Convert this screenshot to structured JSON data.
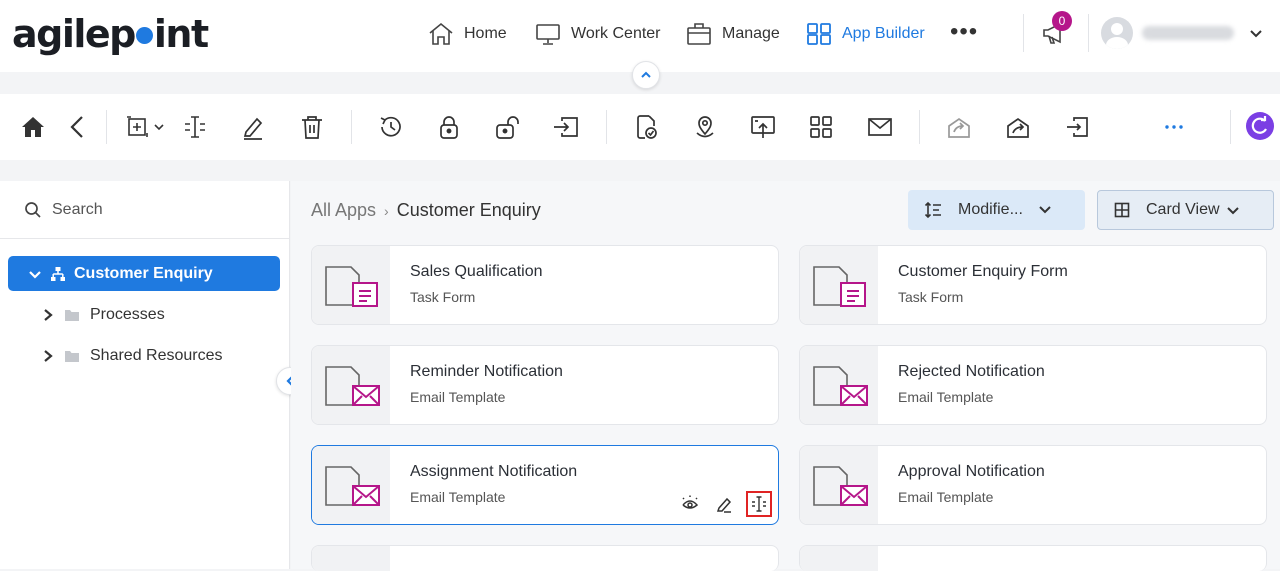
{
  "logo": {
    "text_before": "agilep",
    "text_after": "int"
  },
  "nav": {
    "home": "Home",
    "work_center": "Work Center",
    "manage": "Manage",
    "app_builder": "App Builder",
    "more": "•••",
    "notification_count": "0"
  },
  "sidebar": {
    "search_label": "Search",
    "tree": {
      "root": "Customer Enquiry",
      "children": [
        "Processes",
        "Shared Resources"
      ]
    }
  },
  "breadcrumb": {
    "root": "All Apps",
    "separator": "›",
    "current": "Customer Enquiry"
  },
  "controls": {
    "sort_label": "Modifie...",
    "view_label": "Card View"
  },
  "cards": [
    {
      "title": "Sales Qualification",
      "type": "Task Form"
    },
    {
      "title": "Customer Enquiry Form",
      "type": "Task Form"
    },
    {
      "title": "Reminder Notification",
      "type": "Email Template"
    },
    {
      "title": "Rejected Notification",
      "type": "Email Template"
    },
    {
      "title": "Assignment Notification",
      "type": "Email Template"
    },
    {
      "title": "Approval Notification",
      "type": "Email Template"
    }
  ],
  "colors": {
    "accent": "#1f7ae0",
    "magenta": "#b5168a",
    "highlight": "#e02424"
  }
}
